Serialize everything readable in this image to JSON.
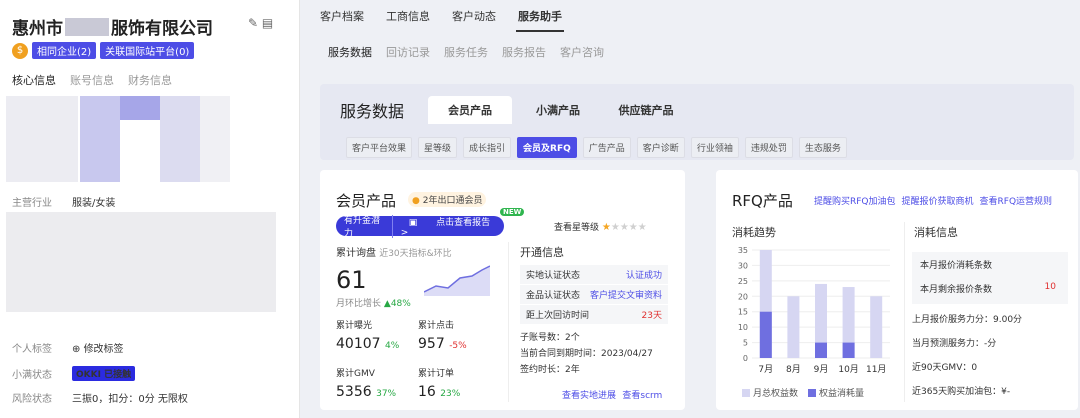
{
  "left": {
    "company_pre": "惠州市",
    "company_post": "服饰有限公司",
    "tag_related": "相同企业(2)",
    "tag_intl": "关联国际站平台(0)",
    "tabs": [
      "核心信息",
      "账号信息",
      "财务信息"
    ],
    "industry_label": "主营行业",
    "industry_value": "服装/女装",
    "personal_tag_label": "个人标签",
    "personal_tag_edit": "修改标签",
    "xiaoman_label": "小满状态",
    "okki": "OKKI",
    "okki_status": "已接触",
    "risk_label": "风险状态",
    "risk_value": "三振0，扣分：0分 无限权"
  },
  "top_tabs": [
    "客户档案",
    "工商信息",
    "客户动态",
    "服务助手"
  ],
  "sub_tabs": [
    "服务数据",
    "回访记录",
    "服务任务",
    "服务报告",
    "客户咨询"
  ],
  "panel": {
    "title": "服务数据",
    "tabs": [
      "会员产品",
      "小满产品",
      "供应链产品"
    ],
    "chips": [
      "客户平台效果",
      "星等级",
      "成长指引",
      "会员及RFQ",
      "广告产品",
      "客户诊断",
      "行业领袖",
      "违规处罚",
      "生态服务"
    ]
  },
  "member": {
    "title": "会员产品",
    "badge": "2年出口通会员",
    "potential": "有升金潜力",
    "report": "点击查看报告 >",
    "new": "NEW",
    "star_link": "查看星等级",
    "stars": 1,
    "star_total": 5,
    "inquiry_label": "累计询盘",
    "inquiry_note": "近30天指标&环比",
    "inquiry_value": "61",
    "mom_label": "月环比增长",
    "mom_value": "48%",
    "exposure_label": "累计曝光",
    "exposure_value": "40107",
    "exposure_pct": "4%",
    "click_label": "累计点击",
    "click_value": "957",
    "click_pct": "-5%",
    "gmv_label": "累计GMV",
    "gmv_value": "5356",
    "gmv_pct": "37%",
    "order_label": "累计订单",
    "order_value": "16",
    "order_pct": "23%",
    "open_info_title": "开通信息",
    "kv": [
      {
        "k": "实地认证状态",
        "v": "认证成功"
      },
      {
        "k": "金品认证状态",
        "v": "客户提交文审资料"
      },
      {
        "k": "距上次回访时间",
        "v": "23天"
      }
    ],
    "sub_account": "子账号数：2个",
    "contract_end": "当前合同到期时间：2023/04/27",
    "sign_duration": "签约时长：2年",
    "link_field": "查看实地进展",
    "link_scrm": "查看scrm"
  },
  "rfq": {
    "title": "RFQ产品",
    "links": [
      "提醒购买RFQ加油包",
      "提醒报价获取商机",
      "查看RFQ运营规则"
    ],
    "trend_title": "消耗趋势",
    "info_title": "消耗信息",
    "quote_used_label": "本月报价消耗条数",
    "quote_used_value": "",
    "quote_left_label": "本月剩余报价条数",
    "quote_left_value": "10",
    "last_score": "上月报价服务力分：9.00分",
    "predicted": "当月预测服务力：-分",
    "gmv90": "近90天GMV：0",
    "fuel365": "近365天购买加油包：¥-"
  },
  "chart_data": {
    "type": "bar",
    "categories": [
      "7月",
      "8月",
      "9月",
      "10月",
      "11月"
    ],
    "series": [
      {
        "name": "月总权益数",
        "values": [
          35,
          20,
          24,
          23,
          20
        ],
        "color": "#d6d6f2"
      },
      {
        "name": "权益消耗量",
        "values": [
          15,
          0,
          5,
          5,
          0
        ],
        "color": "#6f6fe0"
      }
    ],
    "ylim": [
      0,
      35
    ],
    "yticks": [
      0,
      5,
      10,
      15,
      20,
      25,
      30,
      35
    ],
    "grid": true,
    "legend": "bottom"
  }
}
